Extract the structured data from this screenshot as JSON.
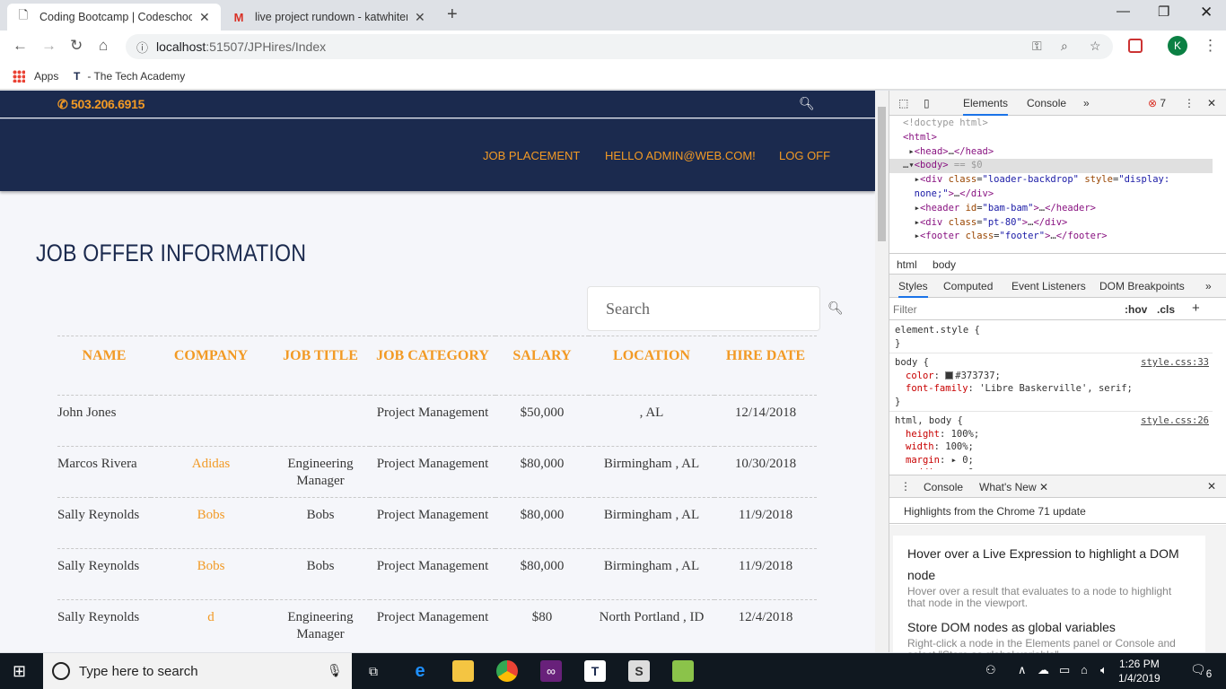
{
  "browser": {
    "tabs": [
      {
        "title": "Coding Bootcamp | Codeschool |",
        "icon": "page-icon"
      },
      {
        "title": "live project rundown - katwhitem",
        "icon": "gmail-icon"
      }
    ],
    "url_host": "localhost",
    "url_path": ":51507/JPHires/Index",
    "profile_initial": "K",
    "bookmarks": [
      "Apps",
      "- The Tech Academy"
    ]
  },
  "site": {
    "phone": "503.206.6915",
    "nav": [
      "JOB PLACEMENT",
      "HELLO ADMIN@WEB.COM!",
      "LOG OFF"
    ],
    "heading": "JOB OFFER INFORMATION",
    "search_placeholder": "Search",
    "colors": {
      "navy": "#1b2a4e",
      "accent": "#f29a25",
      "text": "#373737"
    }
  },
  "table": {
    "headers": [
      "NAME",
      "COMPANY",
      "JOB TITLE",
      "JOB CATEGORY",
      "SALARY",
      "LOCATION",
      "HIRE DATE"
    ],
    "rows": [
      {
        "name": "John Jones",
        "company": "",
        "title": "",
        "category": "Project Management",
        "salary": "$50,000",
        "location": ", AL",
        "date": "12/14/2018"
      },
      {
        "name": "Marcos Rivera",
        "company": "Adidas",
        "title": "Engineering Manager",
        "category": "Project Management",
        "salary": "$80,000",
        "location": "Birmingham , AL",
        "date": "10/30/2018"
      },
      {
        "name": "Sally Reynolds",
        "company": "Bobs",
        "title": "Bobs",
        "category": "Project Management",
        "salary": "$80,000",
        "location": "Birmingham , AL",
        "date": "11/9/2018"
      },
      {
        "name": "Sally Reynolds",
        "company": "Bobs",
        "title": "Bobs",
        "category": "Project Management",
        "salary": "$80,000",
        "location": "Birmingham , AL",
        "date": "11/9/2018"
      },
      {
        "name": "Sally Reynolds",
        "company": "d",
        "title": "Engineering Manager",
        "category": "Project Management",
        "salary": "$80",
        "location": "North Portland , ID",
        "date": "12/4/2018"
      }
    ]
  },
  "devtools": {
    "tabs": [
      "Elements",
      "Console"
    ],
    "error_count": "7",
    "breadcrumbs": [
      "html",
      "body"
    ],
    "style_tabs": [
      "Styles",
      "Computed",
      "Event Listeners",
      "DOM Breakpoints"
    ],
    "filter_placeholder": "Filter",
    "hov": ":hov",
    "cls": ".cls",
    "rule_sources": [
      "style.css:33",
      "style.css:26"
    ],
    "drawer_tabs": [
      "Console",
      "What's New"
    ],
    "highlights": "Highlights from the Chrome 71 update",
    "cards": [
      {
        "title": "Hover over a Live Expression to highlight a DOM node",
        "body": "Hover over a result that evaluates to a node to highlight that node in the viewport."
      },
      {
        "title": "Store DOM nodes as global variables",
        "body": "Right-click a node in the Elements panel or Console and select \"Store as global variable\"."
      }
    ]
  },
  "taskbar": {
    "search_placeholder": "Type here to search",
    "time": "1:26 PM",
    "date": "1/4/2019",
    "notifications": "6"
  }
}
